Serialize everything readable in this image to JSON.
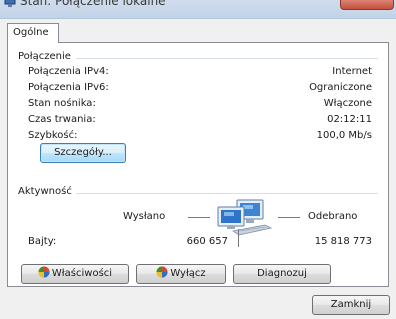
{
  "window": {
    "title": "Stan: Połączenie lokalne"
  },
  "tabs": [
    {
      "label": "Ogólne"
    }
  ],
  "connection": {
    "heading": "Połączenie",
    "rows": [
      {
        "label": "Połączenia IPv4:",
        "value": "Internet"
      },
      {
        "label": "Połączenia IPv6:",
        "value": "Ograniczone"
      },
      {
        "label": "Stan nośnika:",
        "value": "Włączone"
      },
      {
        "label": "Czas trwania:",
        "value": "02:12:11"
      },
      {
        "label": "Szybkość:",
        "value": "100,0 Mb/s"
      }
    ],
    "details_button": "Szczegóły..."
  },
  "activity": {
    "heading": "Aktywność",
    "sent_label": "Wysłano",
    "received_label": "Odebrano",
    "bytes_label": "Bajty:",
    "bytes_sent": "660 657",
    "bytes_received": "15 818 773",
    "icon": "network-computers-icon"
  },
  "actions": {
    "properties_button": "Właściwości",
    "disable_button": "Wyłącz",
    "diagnose_button": "Diagnozuj"
  },
  "footer": {
    "close_button": "Zamknij"
  },
  "colors": {
    "panel_border": "#898c95",
    "group_line": "#d5dfe5",
    "focus_border": "#3c7fb1"
  }
}
